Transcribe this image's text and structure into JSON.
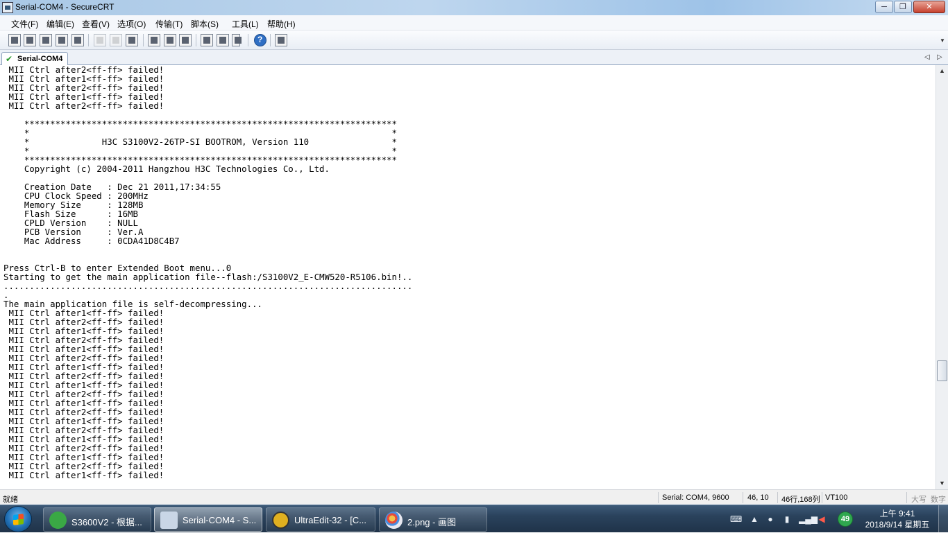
{
  "window": {
    "title": "Serial-COM4 - SecureCRT",
    "minimize": "─",
    "maximize": "❐",
    "close": "✕"
  },
  "menu": [
    "文件(F)",
    "编辑(E)",
    "查看(V)",
    "选项(O)",
    "传输(T)",
    "脚本(S)",
    "工具(L)",
    "帮助(H)"
  ],
  "tabs": [
    {
      "label": "Serial-COM4",
      "icon": "check-icon",
      "active": true
    }
  ],
  "tab_nav": {
    "prev": "◁",
    "next": "▷"
  },
  "terminal": {
    "lines": [
      " MII Ctrl after2<ff-ff> failed!",
      " MII Ctrl after1<ff-ff> failed!",
      " MII Ctrl after2<ff-ff> failed!",
      " MII Ctrl after1<ff-ff> failed!",
      " MII Ctrl after2<ff-ff> failed!",
      "",
      "    ************************************************************************",
      "    *                                                                      *",
      "    *              H3C S3100V2-26TP-SI BOOTROM, Version 110                *",
      "    *                                                                      *",
      "    ************************************************************************",
      "    Copyright (c) 2004-2011 Hangzhou H3C Technologies Co., Ltd.",
      "",
      "    Creation Date   : Dec 21 2011,17:34:55",
      "    CPU Clock Speed : 200MHz",
      "    Memory Size     : 128MB",
      "    Flash Size      : 16MB",
      "    CPLD Version    : NULL",
      "    PCB Version     : Ver.A",
      "    Mac Address     : 0CDA41D8C4B7",
      "",
      "",
      "Press Ctrl-B to enter Extended Boot menu...0",
      "Starting to get the main application file--flash:/S3100V2_E-CMW520-R5106.bin!..",
      "...............................................................................",
      ".",
      "The main application file is self-decompressing...",
      " MII Ctrl after1<ff-ff> failed!",
      " MII Ctrl after2<ff-ff> failed!",
      " MII Ctrl after1<ff-ff> failed!",
      " MII Ctrl after2<ff-ff> failed!",
      " MII Ctrl after1<ff-ff> failed!",
      " MII Ctrl after2<ff-ff> failed!",
      " MII Ctrl after1<ff-ff> failed!",
      " MII Ctrl after2<ff-ff> failed!",
      " MII Ctrl after1<ff-ff> failed!",
      " MII Ctrl after2<ff-ff> failed!",
      " MII Ctrl after1<ff-ff> failed!",
      " MII Ctrl after2<ff-ff> failed!",
      " MII Ctrl after1<ff-ff> failed!",
      " MII Ctrl after2<ff-ff> failed!",
      " MII Ctrl after1<ff-ff> failed!",
      " MII Ctrl after2<ff-ff> failed!",
      " MII Ctrl after1<ff-ff> failed!",
      " MII Ctrl after2<ff-ff> failed!",
      " MII Ctrl after1<ff-ff> failed!"
    ]
  },
  "status": {
    "left": "就绪",
    "connection": "Serial: COM4, 9600",
    "cursor": "46,  10",
    "size": "46行,168列",
    "emulation": "VT100",
    "caps": "大写",
    "num": "数字"
  },
  "taskbar": {
    "tasks": [
      {
        "label": "S3600V2 - 根据...",
        "icon": "browser-icon",
        "color": "#3aa845"
      },
      {
        "label": "Serial-COM4 - S...",
        "icon": "securecrt-icon",
        "color": "#c9d6e6",
        "active": true
      },
      {
        "label": "UltraEdit-32 - [C...",
        "icon": "ultraedit-icon",
        "color": "#e0b020"
      },
      {
        "label": "2.png - 画图",
        "icon": "paint-icon",
        "color": "#e8e8f0"
      }
    ],
    "qq_badge": "49",
    "clock_time": "上午 9:41",
    "clock_date": "2018/9/14 星期五"
  }
}
